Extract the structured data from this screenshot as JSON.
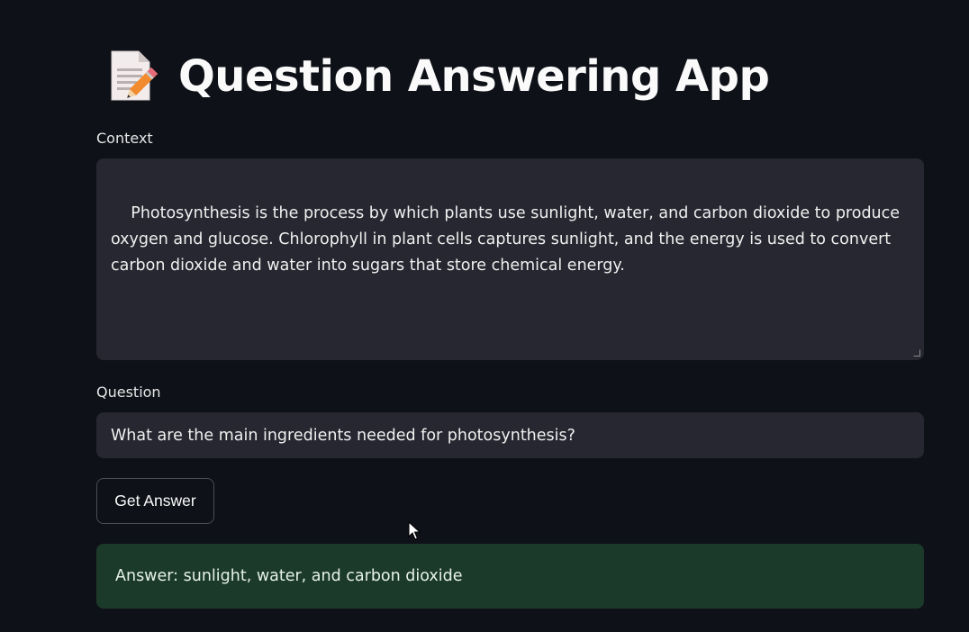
{
  "app": {
    "title": "Question Answering App",
    "title_icon": "memo-pencil-icon"
  },
  "context": {
    "label": "Context",
    "value": "Photosynthesis is the process by which plants use sunlight, water, and carbon dioxide to produce oxygen and glucose. Chlorophyll in plant cells captures sunlight, and the energy is used to convert carbon dioxide and water into sugars that store chemical energy."
  },
  "question": {
    "label": "Question",
    "value": "What are the main ingredients needed for photosynthesis?"
  },
  "button": {
    "label": "Get Answer"
  },
  "answer": {
    "text": "Answer: sunlight, water, and carbon dioxide"
  },
  "colors": {
    "background": "#0e1117",
    "input_background": "#262730",
    "success_background": "#1c3a29"
  }
}
